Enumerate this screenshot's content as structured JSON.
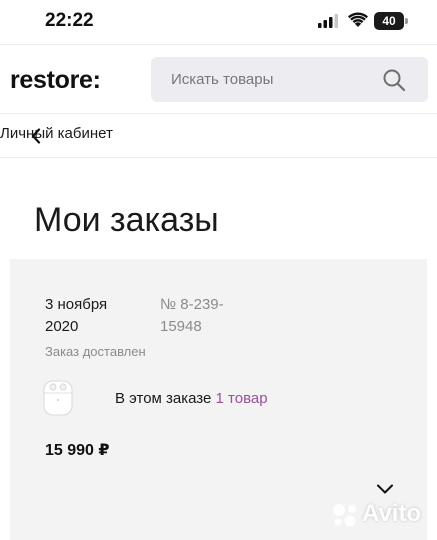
{
  "status_bar": {
    "time": "22:22",
    "battery": "40"
  },
  "header": {
    "logo": "restore:",
    "search_placeholder": "Искать товары"
  },
  "breadcrumb": {
    "back_label": "Личный кабинет"
  },
  "page": {
    "title": "Мои заказы"
  },
  "order": {
    "date": "3 ноября 2020",
    "number": "№ 8-239-15948",
    "status": "Заказ доставлен",
    "items_prefix": "В этом заказе",
    "items_link": "1 товар",
    "price": "15 990 ₽",
    "product_icon": "airpods-case-icon"
  },
  "watermark": {
    "text": "Avito"
  },
  "colors": {
    "accent_link": "#9a4f9a",
    "card_background": "#f3f3f3",
    "search_background": "#ececf1",
    "muted_text": "#8b8b8b"
  }
}
